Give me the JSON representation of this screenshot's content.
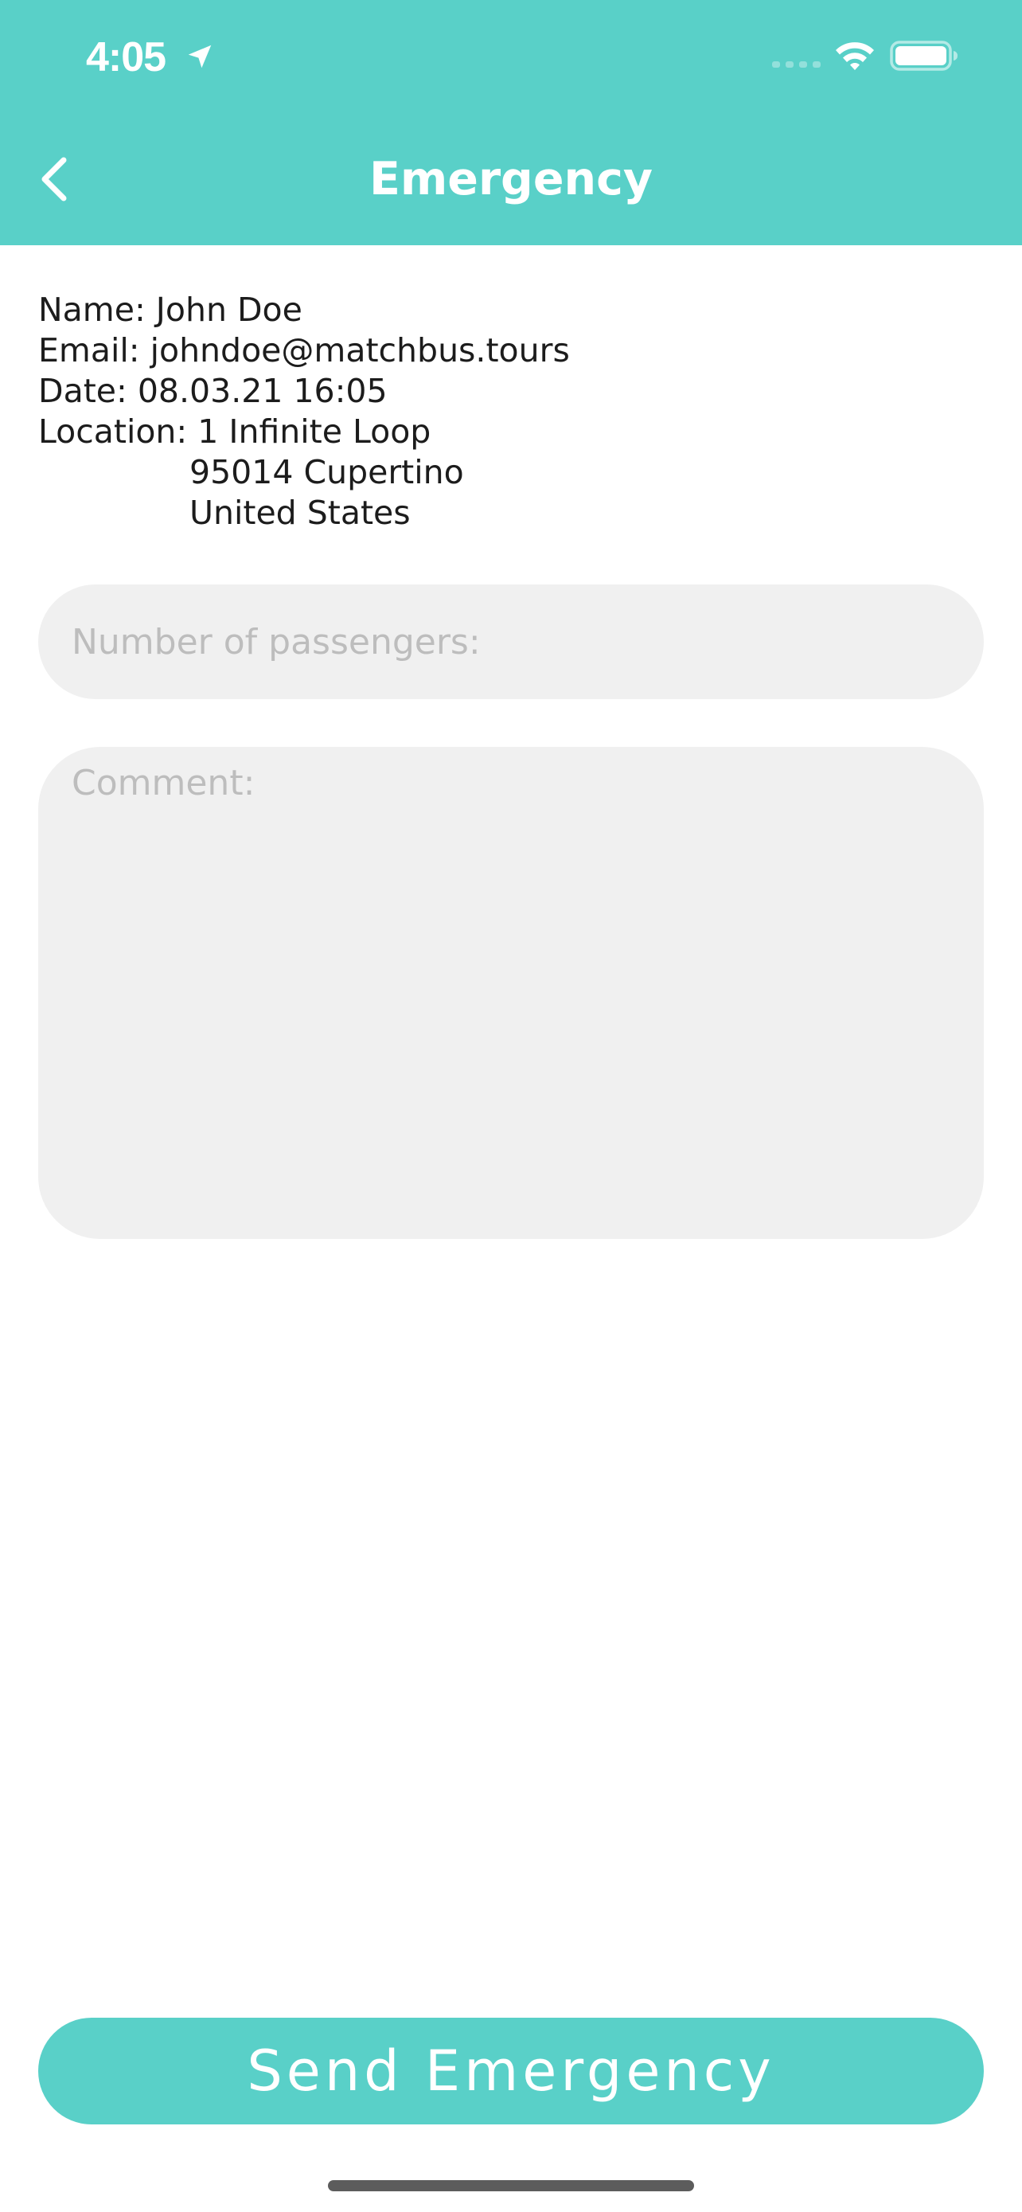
{
  "status_bar": {
    "time": "4:05",
    "icons": [
      "location-arrow-icon",
      "signal-icon",
      "wifi-icon",
      "battery-icon"
    ]
  },
  "header": {
    "title": "Emergency",
    "back_icon": "chevron-left-icon",
    "background_color": "#59D0C8"
  },
  "info": {
    "name": "Name: John Doe",
    "email": "Email: johndoe@matchbus.tours",
    "date": "Date: 08.03.21 16:05",
    "location_line1": "Location: 1 Infinite Loop",
    "location_line2": "95014 Cupertino",
    "location_line3": "United States"
  },
  "form": {
    "passengers_placeholder": "Number of passengers:",
    "passengers_value": "",
    "comment_placeholder": "Comment:",
    "comment_value": ""
  },
  "actions": {
    "send_label": "Send Emergency",
    "accent_color": "#59D0C8"
  }
}
